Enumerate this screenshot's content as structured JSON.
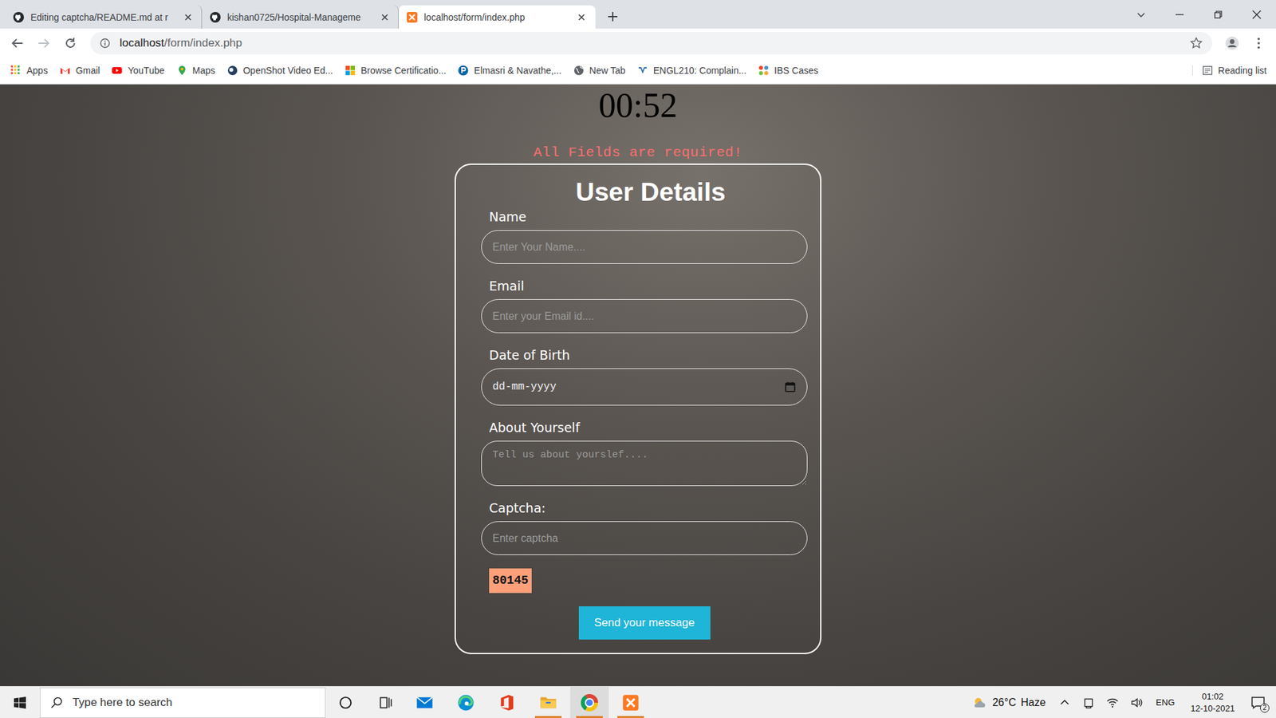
{
  "tabs": [
    {
      "label": "Editing captcha/README.md at r",
      "kind": "github",
      "selected": false
    },
    {
      "label": "kishan0725/Hospital-Manageme",
      "kind": "github",
      "selected": false
    },
    {
      "label": "localhost/form/index.php",
      "kind": "xampp",
      "selected": true
    }
  ],
  "address_bar": {
    "host": "localhost",
    "path": "/form/index.php"
  },
  "bookmarks": [
    {
      "label": "Apps",
      "kind": "apps"
    },
    {
      "label": "Gmail",
      "kind": "gmail"
    },
    {
      "label": "YouTube",
      "kind": "youtube"
    },
    {
      "label": "Maps",
      "kind": "maps"
    },
    {
      "label": "OpenShot Video Ed...",
      "kind": "openshot"
    },
    {
      "label": "Browse Certificatio...",
      "kind": "microsoft"
    },
    {
      "label": "Elmasri & Navathe,...",
      "kind": "pearson"
    },
    {
      "label": "New Tab",
      "kind": "globe"
    },
    {
      "label": "ENGL210: Complain...",
      "kind": "canvas"
    },
    {
      "label": "IBS Cases",
      "kind": "joomla"
    }
  ],
  "reading_list": "Reading list",
  "page": {
    "timer": "00:52",
    "error": "All Fields are required!",
    "form": {
      "title": "User Details",
      "fields": [
        {
          "label": "Name",
          "placeholder": "Enter Your Name....",
          "kind": "text"
        },
        {
          "label": "Email",
          "placeholder": "Enter your Email id....",
          "kind": "text"
        },
        {
          "label": "Date of Birth",
          "placeholder": "dd-mm-yyyy",
          "kind": "date"
        },
        {
          "label": "About Yourself",
          "placeholder": "Tell us about yourslef....",
          "kind": "textarea"
        },
        {
          "label": "Captcha:",
          "placeholder": "Enter captcha",
          "kind": "text"
        }
      ],
      "captcha_code": "80145",
      "submit": "Send your message"
    }
  },
  "taskbar": {
    "search": {
      "placeholder": "Type here to search"
    },
    "apps": [
      {
        "kind": "mail",
        "running": false,
        "selected": false
      },
      {
        "kind": "edge",
        "running": false,
        "selected": false
      },
      {
        "kind": "office",
        "running": false,
        "selected": false
      },
      {
        "kind": "explorer",
        "running": true,
        "selected": false
      },
      {
        "kind": "chrome",
        "running": true,
        "selected": true
      },
      {
        "kind": "xampp",
        "running": true,
        "selected": false
      }
    ],
    "weather": {
      "temperature": "26°C",
      "condition": "Haze"
    },
    "language": "ENG",
    "time": "01:02",
    "date": "12-10-2021",
    "notifications": "2"
  }
}
